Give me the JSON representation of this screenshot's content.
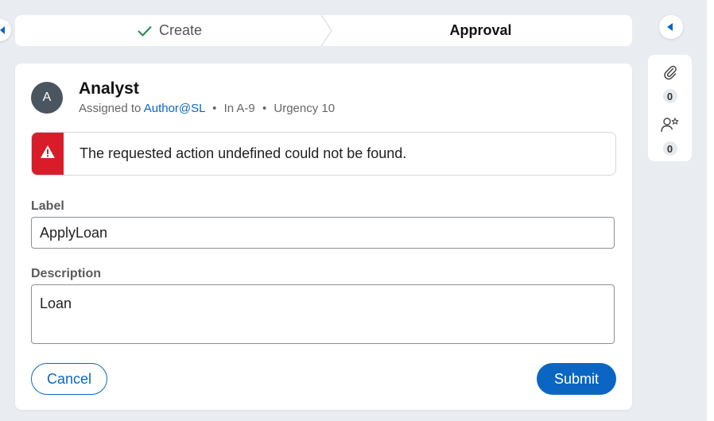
{
  "stages": {
    "items": [
      {
        "label": "Create",
        "status": "completed"
      },
      {
        "label": "Approval",
        "status": "current"
      }
    ]
  },
  "utility": {
    "attachments_count": "0",
    "followers_count": "0"
  },
  "case": {
    "avatar_initial": "A",
    "title": "Analyst",
    "assigned_prefix": "Assigned to",
    "assignee": "Author@SL",
    "location": "In A-9",
    "urgency": "Urgency 10"
  },
  "alert": {
    "message": "The requested action undefined could not be found."
  },
  "form": {
    "label_field": {
      "label": "Label",
      "value": "ApplyLoan"
    },
    "description_field": {
      "label": "Description",
      "value": "Loan"
    }
  },
  "actions": {
    "cancel_label": "Cancel",
    "submit_label": "Submit"
  },
  "colors": {
    "accent": "#0b66c3",
    "error": "#d91c29",
    "background": "#e9edf2"
  }
}
